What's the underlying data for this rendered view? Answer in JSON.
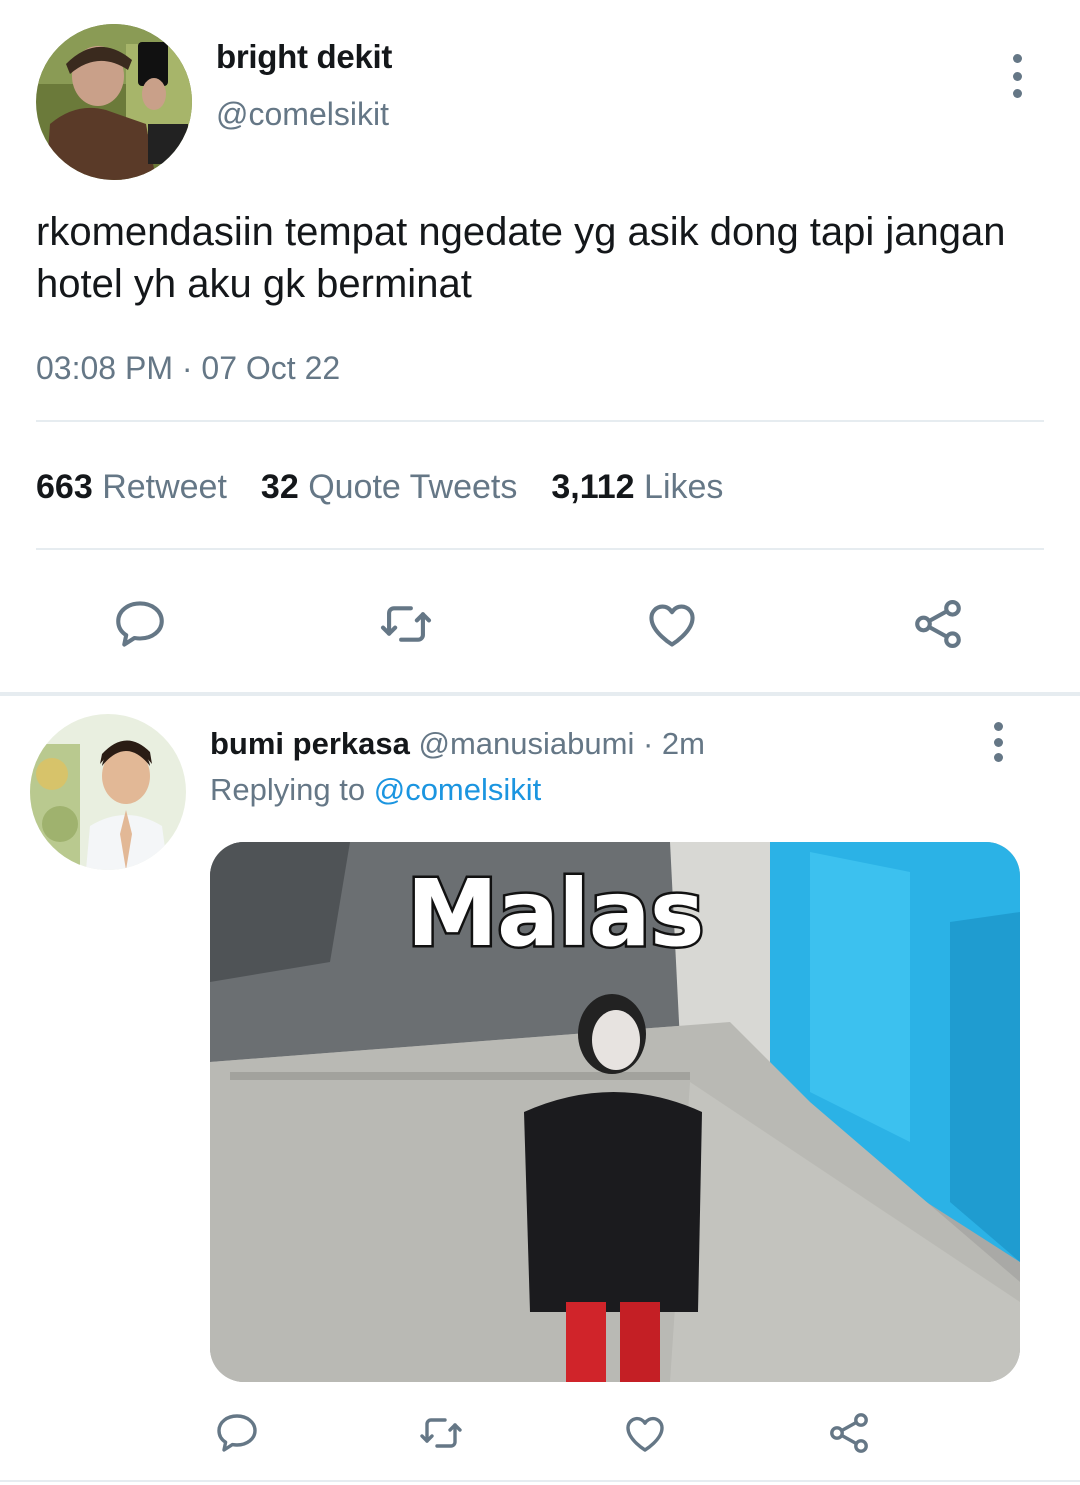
{
  "main_tweet": {
    "author_name": "bright dekit",
    "author_handle": "@comelsikit",
    "text": "rkomendasiin tempat ngedate yg asik dong tapi jangan hotel yh aku gk berminat",
    "timestamp": "03:08 PM · 07 Oct 22",
    "stats": {
      "retweets_count": "663",
      "retweets_label": "Retweet",
      "quotes_count": "32",
      "quotes_label": "Quote Tweets",
      "likes_count": "3,112",
      "likes_label": "Likes"
    },
    "actions": [
      "reply-icon",
      "retweet-icon",
      "like-icon",
      "share-icon"
    ]
  },
  "reply": {
    "author_name": "bumi perkasa",
    "author_handle": "@manusiabumi",
    "time": "· 2m",
    "replying_prefix": "Replying to",
    "replying_to": "@comelsikit",
    "media_caption": "Malas",
    "actions": [
      "reply-icon",
      "retweet-icon",
      "like-icon",
      "share-icon"
    ]
  },
  "colors": {
    "text_primary": "#14171a",
    "text_secondary": "#657786",
    "link": "#1b95e0",
    "divider": "#e6ecf0"
  }
}
